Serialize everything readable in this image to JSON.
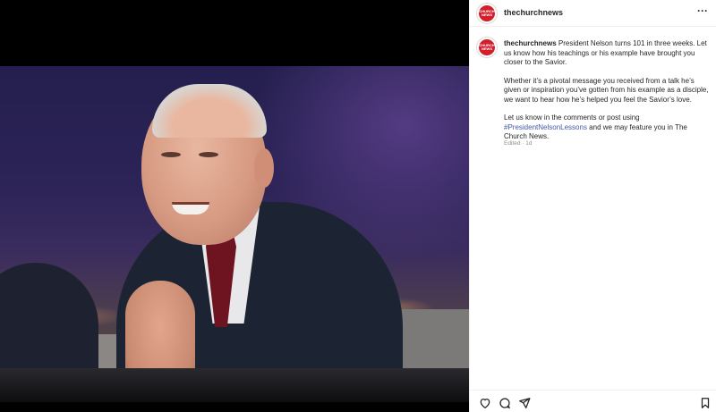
{
  "post": {
    "username": "thechurchnews",
    "avatar_text": "CHURCH NEWS",
    "more_label": "···",
    "caption": {
      "username": "thechurchnews",
      "p1": " President Nelson turns 101 in three weeks. Let us know how his teachings or his example have brought you closer to the Savior.",
      "p2": "Whether it’s a pivotal message you received from a talk he’s given or inspiration you’ve gotten from his example as a disciple, we want to hear how he’s helped you feel the Savior’s love.",
      "p3_before": "Let us know in the comments or post using ",
      "hashtag": "#PresidentNelsonLessons",
      "p3_after": " and we may feature you in The Church News."
    },
    "meta": "Edited · 1d"
  },
  "actions": {
    "like_icon": "heart-icon",
    "comment_icon": "comment-icon",
    "share_icon": "paper-plane-icon",
    "save_icon": "bookmark-icon"
  },
  "colors": {
    "brand": "#d21f2b",
    "hashtag": "#4159a8",
    "muted": "#8e8e8e"
  }
}
